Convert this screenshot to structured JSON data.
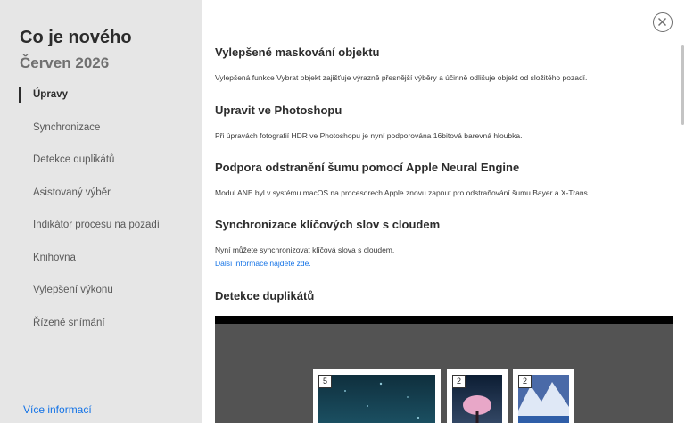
{
  "sidebar": {
    "title": "Co je nového",
    "subtitle": "Červen 2026",
    "items": [
      {
        "label": "Úpravy",
        "active": true
      },
      {
        "label": "Synchronizace"
      },
      {
        "label": "Detekce duplikátů"
      },
      {
        "label": "Asistovaný výběr"
      },
      {
        "label": "Indikátor procesu na pozadí"
      },
      {
        "label": "Knihovna"
      },
      {
        "label": "Vylepšení výkonu"
      },
      {
        "label": "Řízené snímání"
      }
    ],
    "more_link": "Více informací"
  },
  "close_icon": "close-icon",
  "sections": [
    {
      "heading": "Vylepšené maskování objektu",
      "text": "Vylepšená funkce Vybrat objekt zajišťuje výrazně přesnější výběry a účinně odlišuje objekt od složitého pozadí."
    },
    {
      "heading": "Upravit ve Photoshopu",
      "text": "Při úpravách fotografií HDR ve Photoshopu je nyní podporována 16bitová barevná hloubka."
    },
    {
      "heading": "Podpora odstranění šumu pomocí Apple Neural Engine",
      "text": "Modul ANE byl v systému macOS na procesorech Apple znovu zapnut pro odstraňování šumu Bayer a X-Trans."
    },
    {
      "heading": "Synchronizace klíčových slov s cloudem",
      "text": "Nyní můžete synchronizovat klíčová slova s cloudem.",
      "link": "Další informace najdete zde."
    },
    {
      "heading": "Detekce duplikátů"
    }
  ],
  "preview": {
    "stacks": [
      {
        "count": "5"
      },
      {
        "count": "2"
      },
      {
        "count": "2"
      }
    ]
  },
  "colors": {
    "accent": "#1473e6",
    "sidebar_bg": "#e6e6e6",
    "preview_bg": "#535353"
  }
}
